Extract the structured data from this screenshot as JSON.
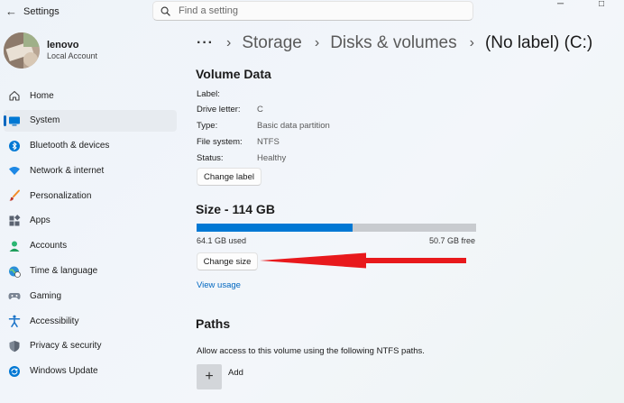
{
  "window": {
    "back_icon": "back-arrow-icon",
    "title": "Settings",
    "search_placeholder": "Find a setting",
    "controls": {
      "minimize": "─",
      "maximize": "□"
    }
  },
  "profile": {
    "name": "lenovo",
    "account_type": "Local Account"
  },
  "nav": {
    "items": [
      {
        "label": "Home",
        "icon": "home-icon"
      },
      {
        "label": "System",
        "icon": "system-display-icon",
        "active": true
      },
      {
        "label": "Bluetooth & devices",
        "icon": "bluetooth-icon"
      },
      {
        "label": "Network & internet",
        "icon": "wifi-icon"
      },
      {
        "label": "Personalization",
        "icon": "brush-icon"
      },
      {
        "label": "Apps",
        "icon": "apps-icon"
      },
      {
        "label": "Accounts",
        "icon": "accounts-icon"
      },
      {
        "label": "Time & language",
        "icon": "globe-clock-icon"
      },
      {
        "label": "Gaming",
        "icon": "gamepad-icon"
      },
      {
        "label": "Accessibility",
        "icon": "accessibility-icon"
      },
      {
        "label": "Privacy & security",
        "icon": "shield-icon"
      },
      {
        "label": "Windows Update",
        "icon": "update-icon"
      }
    ]
  },
  "breadcrumb": {
    "more": "···",
    "separator": "›",
    "items": [
      "Storage",
      "Disks & volumes"
    ],
    "current": "(No label) (C:)"
  },
  "volume_data": {
    "title": "Volume Data",
    "rows": [
      {
        "label": "Label:",
        "value": ""
      },
      {
        "label": "Drive letter:",
        "value": "C"
      },
      {
        "label": "Type:",
        "value": "Basic data partition"
      },
      {
        "label": "File system:",
        "value": "NTFS"
      },
      {
        "label": "Status:",
        "value": "Healthy"
      }
    ],
    "change_label_button": "Change label"
  },
  "size": {
    "title": "Size - 114 GB",
    "used_label": "64.1 GB used",
    "free_label": "50.7 GB free",
    "used_fraction": 0.558,
    "change_size_button": "Change size",
    "view_usage_link": "View usage"
  },
  "paths": {
    "title": "Paths",
    "description": "Allow access to this volume using the following NTFS paths.",
    "add_icon": "+",
    "add_label": "Add"
  },
  "annotation": {
    "color": "#e8191c"
  },
  "colors": {
    "accent": "#0078d4",
    "bar_free": "#c8cbcf"
  }
}
